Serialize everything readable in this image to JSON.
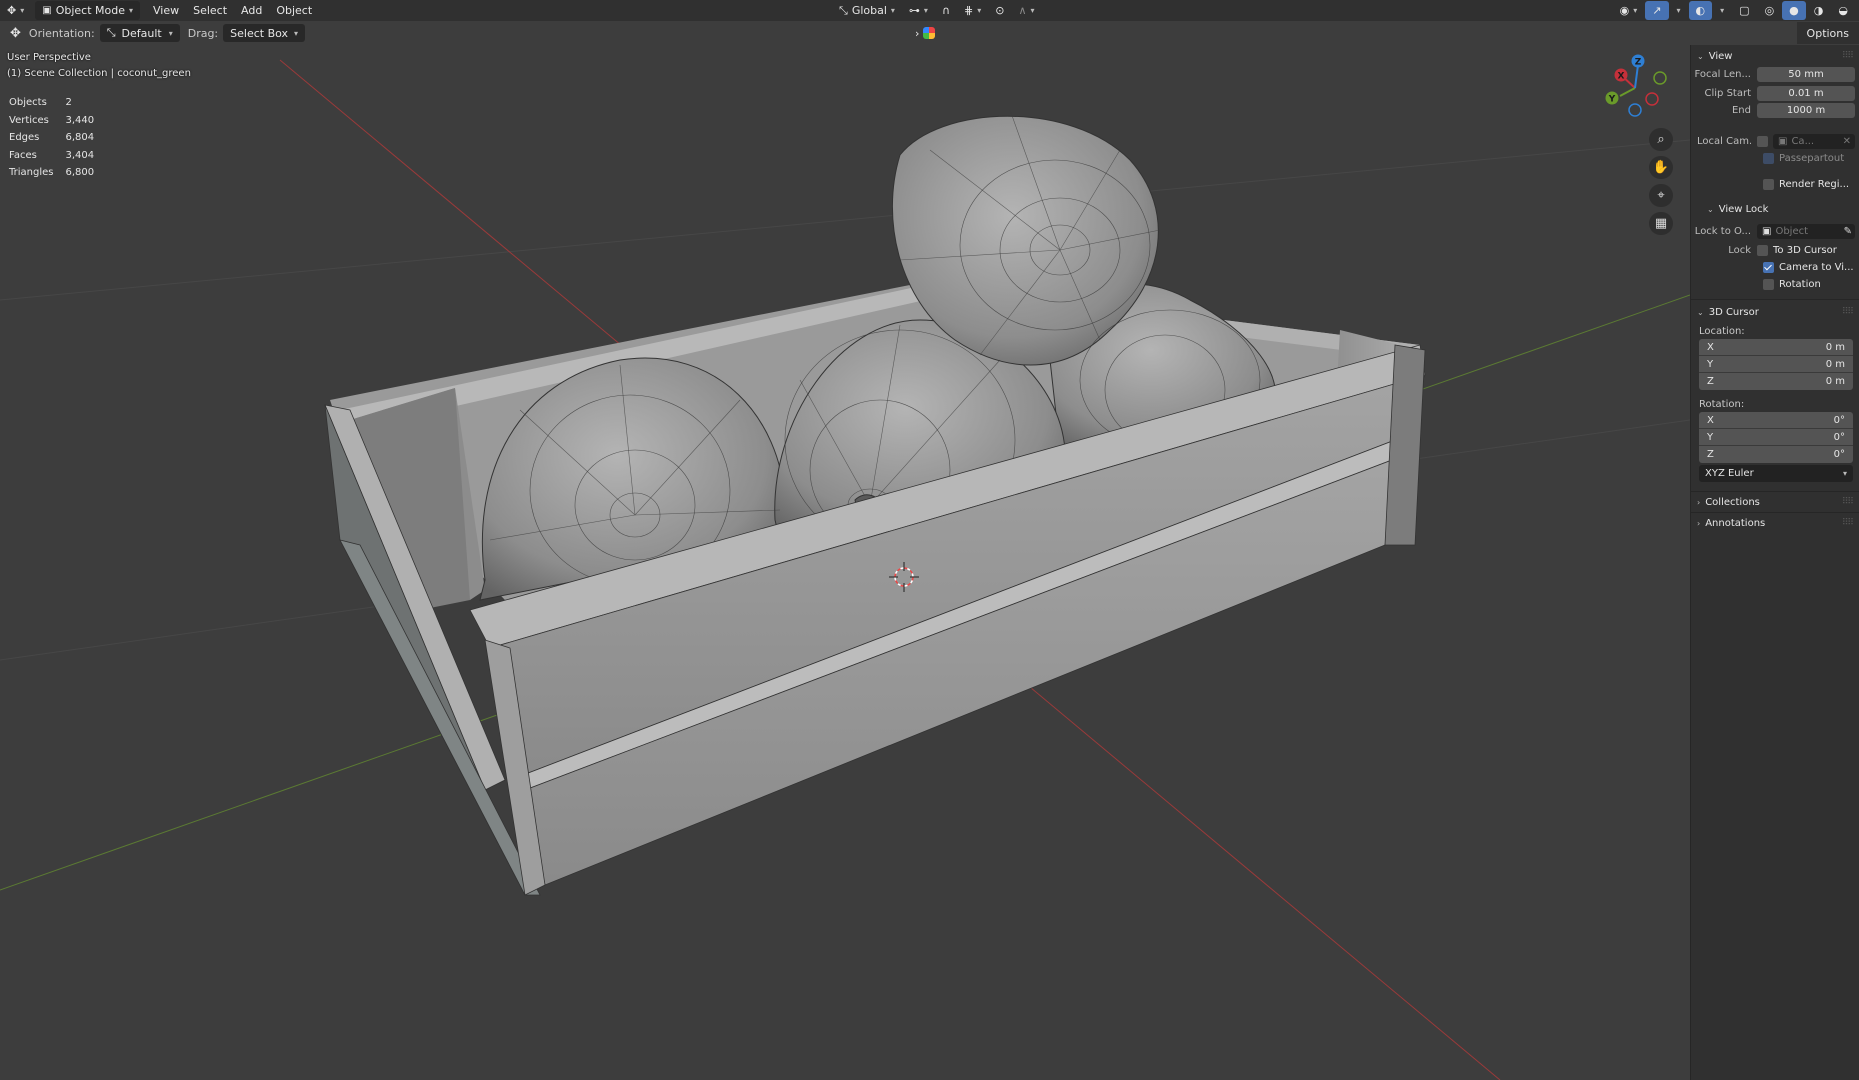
{
  "header": {
    "mode": "Object Mode",
    "menus": [
      "View",
      "Select",
      "Add",
      "Object"
    ],
    "transform_orientation": "Global",
    "options_label": "Options"
  },
  "tool_settings": {
    "orientation_label": "Orientation:",
    "orientation_value": "Default",
    "drag_label": "Drag:",
    "drag_value": "Select Box"
  },
  "viewport": {
    "perspective": "User Perspective",
    "collection": "(1) Scene Collection | coconut_green",
    "stats": [
      {
        "label": "Objects",
        "value": "2"
      },
      {
        "label": "Vertices",
        "value": "3,440"
      },
      {
        "label": "Edges",
        "value": "6,804"
      },
      {
        "label": "Faces",
        "value": "3,404"
      },
      {
        "label": "Triangles",
        "value": "6,800"
      }
    ],
    "gizmo_axes": [
      "X",
      "Y",
      "Z"
    ]
  },
  "sidebar": {
    "view_panel": {
      "title": "View",
      "focal_length_label": "Focal Len...",
      "focal_length": "50 mm",
      "clip_start_label": "Clip Start",
      "clip_start": "0.01 m",
      "clip_end_label": "End",
      "clip_end": "1000 m",
      "local_camera_label": "Local Cam...",
      "local_camera_value": "Ca...",
      "passepartout_label": "Passepartout",
      "render_region_label": "Render Regi..."
    },
    "view_lock": {
      "title": "View Lock",
      "lock_to_object_label": "Lock to O...",
      "lock_to_object_placeholder": "Object",
      "lock_label": "Lock",
      "to_3d_cursor": "To 3D Cursor",
      "camera_to_view": "Camera to Vi...",
      "rotation": "Rotation"
    },
    "cursor_panel": {
      "title": "3D Cursor",
      "location_label": "Location:",
      "location": [
        {
          "axis": "X",
          "value": "0 m"
        },
        {
          "axis": "Y",
          "value": "0 m"
        },
        {
          "axis": "Z",
          "value": "0 m"
        }
      ],
      "rotation_label": "Rotation:",
      "rotation": [
        {
          "axis": "X",
          "value": "0°"
        },
        {
          "axis": "Y",
          "value": "0°"
        },
        {
          "axis": "Z",
          "value": "0°"
        }
      ],
      "rotation_mode": "XYZ Euler"
    },
    "collections_title": "Collections",
    "annotations_title": "Annotations"
  },
  "colors": {
    "axis_x": "#c5303a",
    "axis_y": "#6a9a2a",
    "axis_z": "#2e7fd4",
    "accent": "#4772b3",
    "viewport_bg": "#3d3d3d"
  }
}
